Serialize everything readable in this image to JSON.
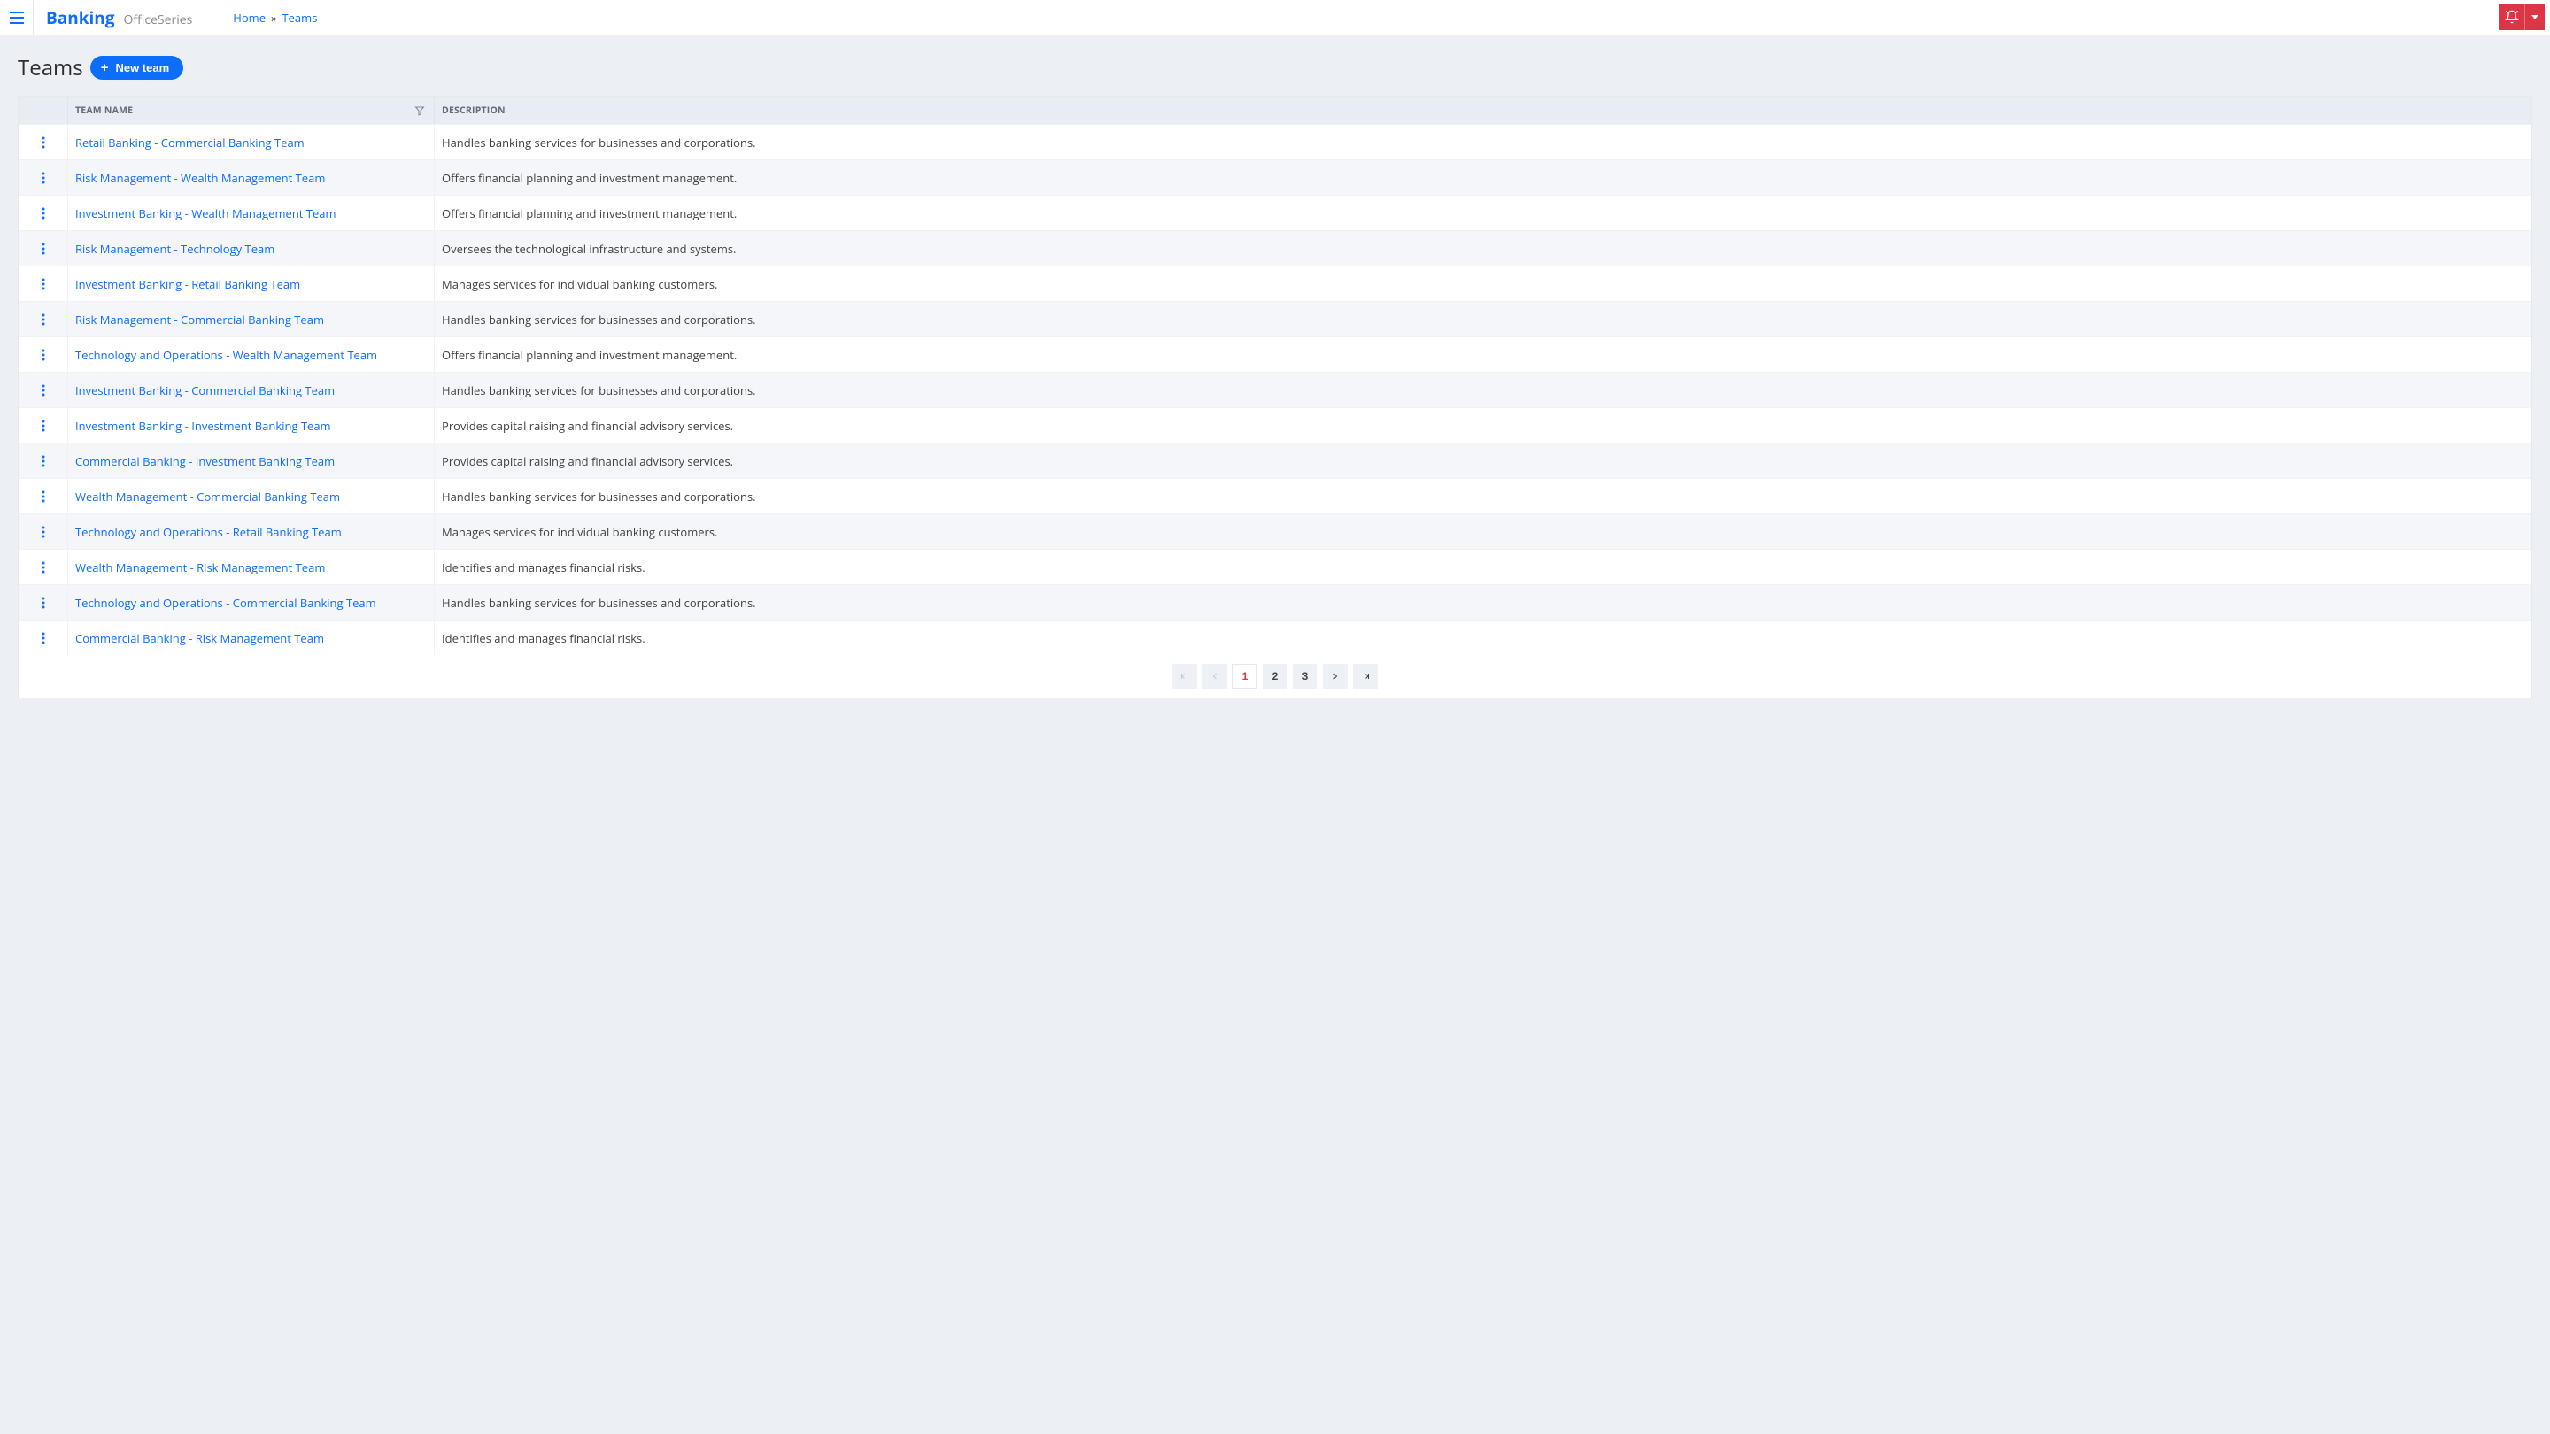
{
  "brand": {
    "main": "Banking",
    "sub": "OfficeSeries"
  },
  "breadcrumb": {
    "home": "Home",
    "sep": "»",
    "current": "Teams"
  },
  "page": {
    "title": "Teams",
    "newButton": "New team"
  },
  "columns": {
    "name": "TEAM NAME",
    "description": "DESCRIPTION"
  },
  "rows": [
    {
      "name": "Retail Banking - Commercial Banking Team",
      "desc": "Handles banking services for businesses and corporations."
    },
    {
      "name": "Risk Management - Wealth Management Team",
      "desc": "Offers financial planning and investment management."
    },
    {
      "name": "Investment Banking - Wealth Management Team",
      "desc": "Offers financial planning and investment management."
    },
    {
      "name": "Risk Management - Technology Team",
      "desc": "Oversees the technological infrastructure and systems."
    },
    {
      "name": "Investment Banking - Retail Banking Team",
      "desc": "Manages services for individual banking customers."
    },
    {
      "name": "Risk Management - Commercial Banking Team",
      "desc": "Handles banking services for businesses and corporations."
    },
    {
      "name": "Technology and Operations - Wealth Management Team",
      "desc": "Offers financial planning and investment management."
    },
    {
      "name": "Investment Banking - Commercial Banking Team",
      "desc": "Handles banking services for businesses and corporations."
    },
    {
      "name": "Investment Banking - Investment Banking Team",
      "desc": "Provides capital raising and financial advisory services."
    },
    {
      "name": "Commercial Banking - Investment Banking Team",
      "desc": "Provides capital raising and financial advisory services."
    },
    {
      "name": "Wealth Management - Commercial Banking Team",
      "desc": "Handles banking services for businesses and corporations."
    },
    {
      "name": "Technology and Operations - Retail Banking Team",
      "desc": "Manages services for individual banking customers."
    },
    {
      "name": "Wealth Management - Risk Management Team",
      "desc": "Identifies and manages financial risks."
    },
    {
      "name": "Technology and Operations - Commercial Banking Team",
      "desc": "Handles banking services for businesses and corporations."
    },
    {
      "name": "Commercial Banking - Risk Management Team",
      "desc": "Identifies and manages financial risks."
    }
  ],
  "pager": {
    "pages": [
      "1",
      "2",
      "3"
    ],
    "current": "1"
  }
}
